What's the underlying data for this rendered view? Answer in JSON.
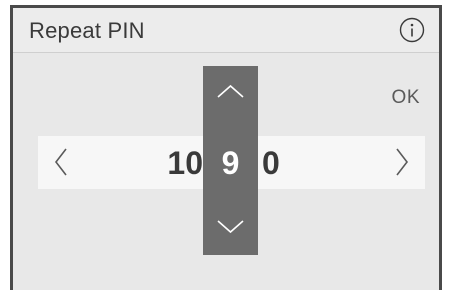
{
  "header": {
    "title": "Repeat PIN",
    "info_icon": "info-icon"
  },
  "actions": {
    "ok_label": "OK"
  },
  "pin": {
    "digits_before": "10",
    "current_digit": "9",
    "digits_after": "0"
  },
  "icons": {
    "previous": "chevron-left-icon",
    "next": "chevron-right-icon",
    "increment": "chevron-up-icon",
    "decrement": "chevron-down-icon"
  },
  "colors": {
    "spinner_background": "#6c6c6c",
    "screen_background": "#e8e8e8",
    "band_background": "#f7f7f7",
    "text": "#3a3a3a"
  }
}
